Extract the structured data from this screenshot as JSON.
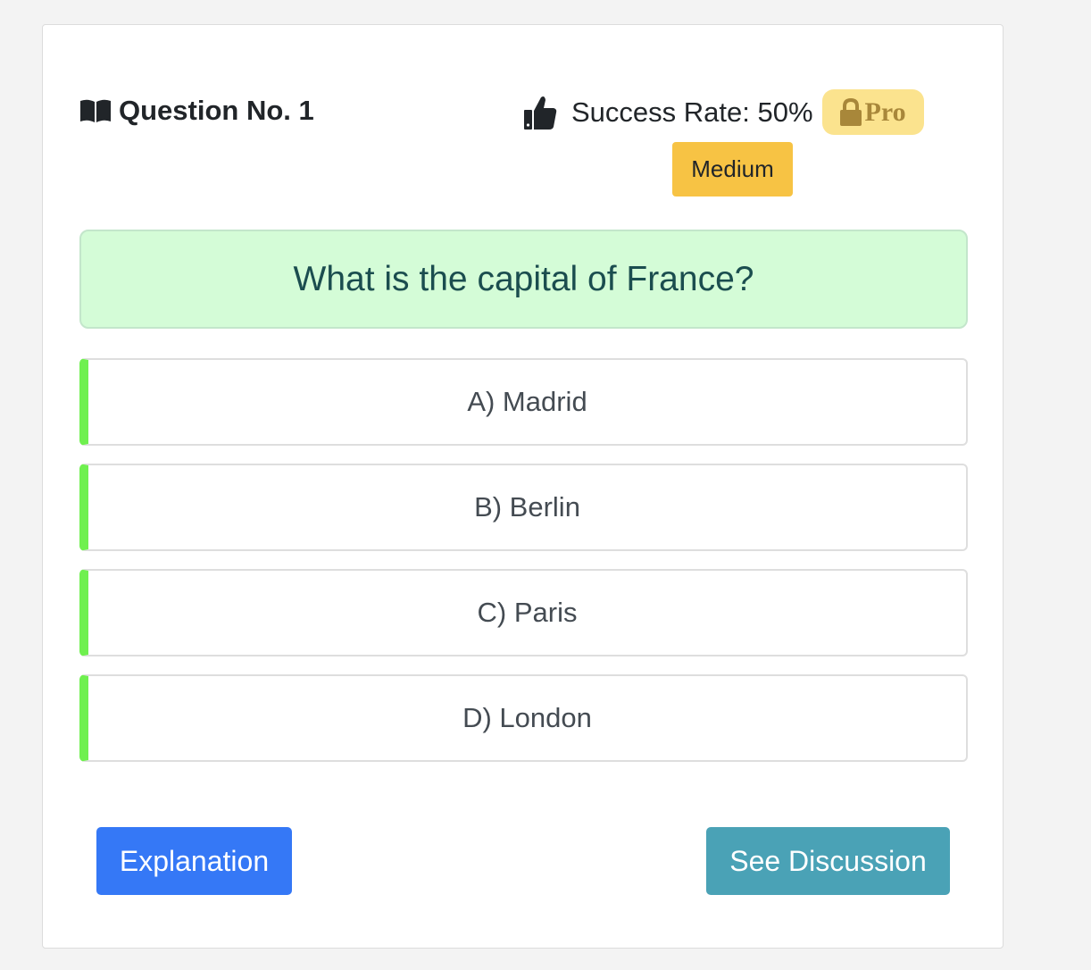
{
  "header": {
    "question_number": "Question No. 1",
    "success_rate": "Success Rate: 50%",
    "pro_label": "Pro",
    "difficulty": "Medium"
  },
  "question": {
    "text": "What is the capital of France?"
  },
  "options": [
    {
      "label": "A) Madrid"
    },
    {
      "label": "B) Berlin"
    },
    {
      "label": "C) Paris"
    },
    {
      "label": "D) London"
    }
  ],
  "actions": {
    "explanation_label": "Explanation",
    "discussion_label": "See Discussion"
  },
  "icons": {
    "question": "book-icon",
    "success": "thumbs-up-icon",
    "pro": "lock-icon"
  },
  "colors": {
    "accent_blue": "#3578f6",
    "accent_teal": "#4aa2b6",
    "difficulty_medium": "#f7c344",
    "option_marker": "#6ff04f",
    "question_bg": "#d4fcd7"
  }
}
